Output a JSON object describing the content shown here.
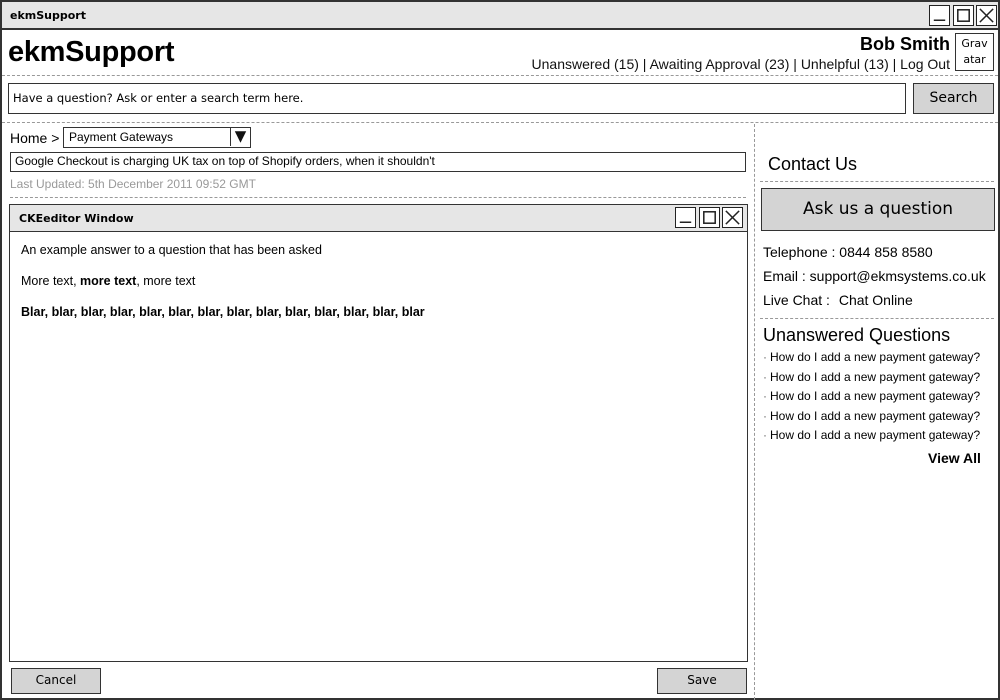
{
  "window": {
    "title": "ekmSupport"
  },
  "header": {
    "brand": "ekmSupport",
    "user_name": "Bob Smith",
    "avatar_text": "Grav atar",
    "nav": {
      "unanswered": "Unanswered (15)",
      "awaiting_approval": "Awaiting Approval (23)",
      "unhelpful": "Unhelpful (13)",
      "logout": "Log Out",
      "separator": "|"
    }
  },
  "search": {
    "placeholder": "Have a question? Ask or enter a search term here.",
    "button_label": "Search"
  },
  "breadcrumb": {
    "home": "Home >",
    "selected_category": "Payment Gateways"
  },
  "question": {
    "title": "Google Checkout is charging UK tax on top of Shopify orders, when it shouldn't",
    "last_updated": "Last Updated: 5th December 2011 09:52 GMT"
  },
  "editor": {
    "title": "CKEeditor Window",
    "line1": "An example answer to a question that has been asked",
    "line2_a": "More text, ",
    "line2_b": "more text",
    "line2_c": ", more text",
    "line3": "Blar, blar, blar, blar, blar, blar, blar, blar, blar, blar, blar, blar, blar, blar"
  },
  "actions": {
    "cancel": "Cancel",
    "save": "Save"
  },
  "sidebar": {
    "contact_title": "Contact Us",
    "ask_button": "Ask us a question",
    "telephone": "Telephone : 0844 858 8580",
    "email": "Email : support@ekmsystems.co.uk",
    "live_chat_label": "Live Chat :",
    "live_chat_link": "Chat Online",
    "unanswered_title": "Unanswered Questions",
    "unanswered_items": [
      "How do I add a new payment gateway?",
      "How do I add a new payment gateway?",
      "How do I add a new payment gateway?",
      "How do I add a new payment gateway?",
      "How do I add a new payment gateway?"
    ],
    "view_all": "View All"
  }
}
